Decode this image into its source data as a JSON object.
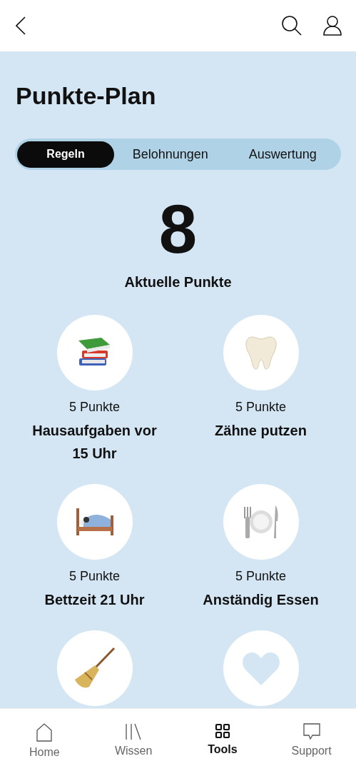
{
  "header": {
    "title": "Punkte-Plan"
  },
  "tabs": [
    {
      "label": "Regeln",
      "selected": true
    },
    {
      "label": "Belohnungen",
      "selected": false
    },
    {
      "label": "Auswertung",
      "selected": false
    }
  ],
  "score": {
    "value": "8",
    "label": "Aktuelle Punkte"
  },
  "rules": [
    {
      "kind": "full",
      "points": "5 Punkte",
      "title": "Hausaufgaben vor 15 Uhr"
    },
    {
      "kind": "full",
      "points": "5 Punkte",
      "title": "Zähne putzen"
    },
    {
      "kind": "full",
      "points": "5 Punkte",
      "title": "Bettzeit 21 Uhr"
    },
    {
      "kind": "full",
      "points": "5 Punkte",
      "title": "Anständig Essen"
    },
    {
      "kind": "cut"
    },
    {
      "kind": "cut"
    }
  ],
  "nav": [
    {
      "label": "Home",
      "selected": false
    },
    {
      "label": "Wissen",
      "selected": false
    },
    {
      "label": "Tools",
      "selected": true
    },
    {
      "label": "Support",
      "selected": false
    }
  ]
}
